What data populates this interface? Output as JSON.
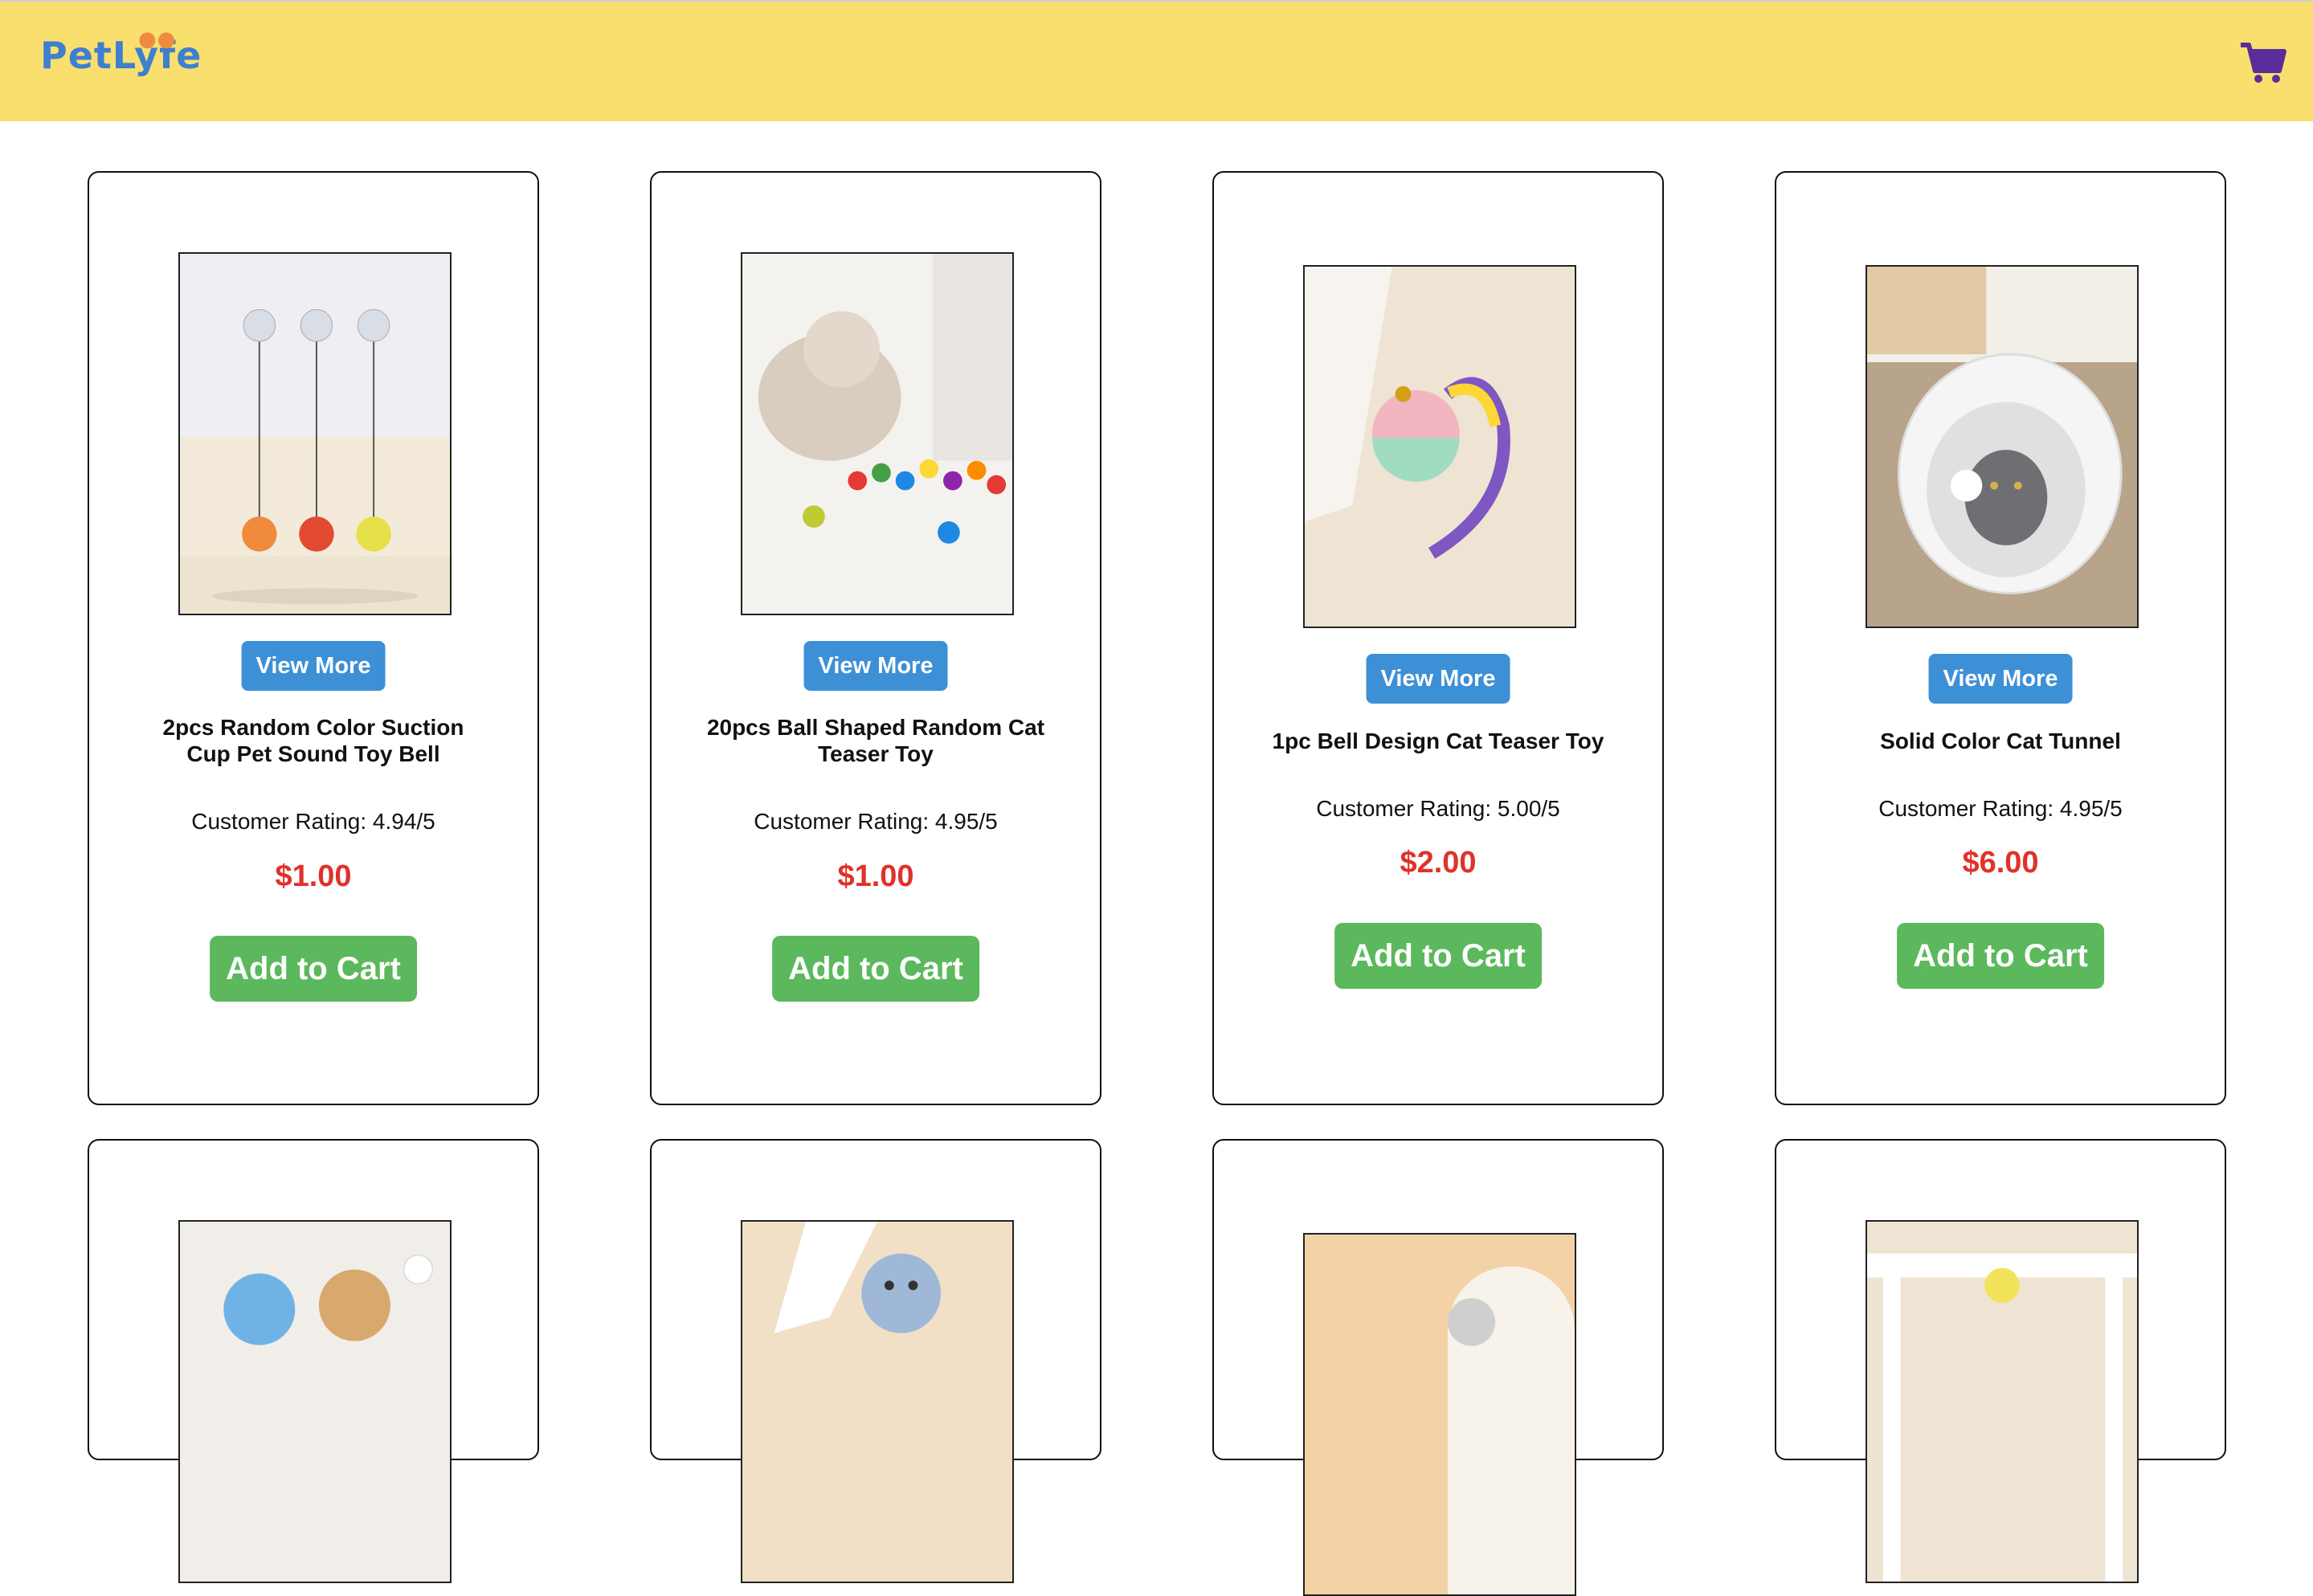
{
  "header": {
    "logo_text": "PetLyfe",
    "cart_icon": "shopping-cart-icon"
  },
  "colors": {
    "header_bg": "#f9df6d",
    "view_more": "#3d8fd6",
    "add_to_cart": "#5cb85c",
    "price": "#e0312b"
  },
  "products": [
    {
      "title_line1": "2pcs Random Color Suction",
      "title_line2": "Cup Pet Sound Toy Bell",
      "rating": "Customer Rating: 4.94/5",
      "price": "$1.00",
      "view_more": "View More",
      "add_to_cart": "Add to Cart"
    },
    {
      "title_line1": "20pcs Ball Shaped Random Cat",
      "title_line2": "Teaser Toy",
      "rating": "Customer Rating: 4.95/5",
      "price": "$1.00",
      "view_more": "View More",
      "add_to_cart": "Add to Cart"
    },
    {
      "title_line1": "1pc Bell Design Cat Teaser Toy",
      "title_line2": "",
      "rating": "Customer Rating: 5.00/5",
      "price": "$2.00",
      "view_more": "View More",
      "add_to_cart": "Add to Cart"
    },
    {
      "title_line1": "Solid Color Cat Tunnel",
      "title_line2": "",
      "rating": "Customer Rating: 4.95/5",
      "price": "$6.00",
      "view_more": "View More",
      "add_to_cart": "Add to Cart"
    }
  ]
}
